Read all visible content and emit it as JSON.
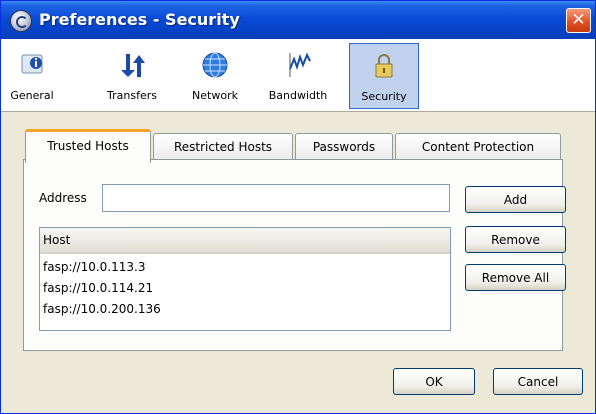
{
  "window": {
    "title": "Preferences - Security",
    "close_glyph": "✕"
  },
  "toolbar": {
    "items": [
      {
        "label": "General",
        "icon": "info-icon",
        "selected": false
      },
      {
        "label": "Transfers",
        "icon": "transfer-arrows-icon",
        "selected": false
      },
      {
        "label": "Network",
        "icon": "globe-icon",
        "selected": false
      },
      {
        "label": "Bandwidth",
        "icon": "bandwidth-graph-icon",
        "selected": false
      },
      {
        "label": "Security",
        "icon": "lock-icon",
        "selected": true
      }
    ]
  },
  "tabs": [
    {
      "label": "Trusted Hosts",
      "active": true
    },
    {
      "label": "Restricted Hosts",
      "active": false
    },
    {
      "label": "Passwords",
      "active": false
    },
    {
      "label": "Content Protection",
      "active": false
    }
  ],
  "address": {
    "label": "Address",
    "value": "",
    "placeholder": ""
  },
  "hosts": {
    "header": "Host",
    "rows": [
      "fasp://10.0.113.3",
      "fasp://10.0.114.21",
      "fasp://10.0.200.136"
    ]
  },
  "buttons": {
    "add": "Add",
    "remove": "Remove",
    "remove_all": "Remove All",
    "ok": "OK",
    "cancel": "Cancel"
  },
  "colors": {
    "titlebar": "#0a4bd6",
    "selected_toolbar": "#c1d2ee",
    "active_tab_accent": "#f7a22a",
    "window_bg": "#ece9d8"
  }
}
